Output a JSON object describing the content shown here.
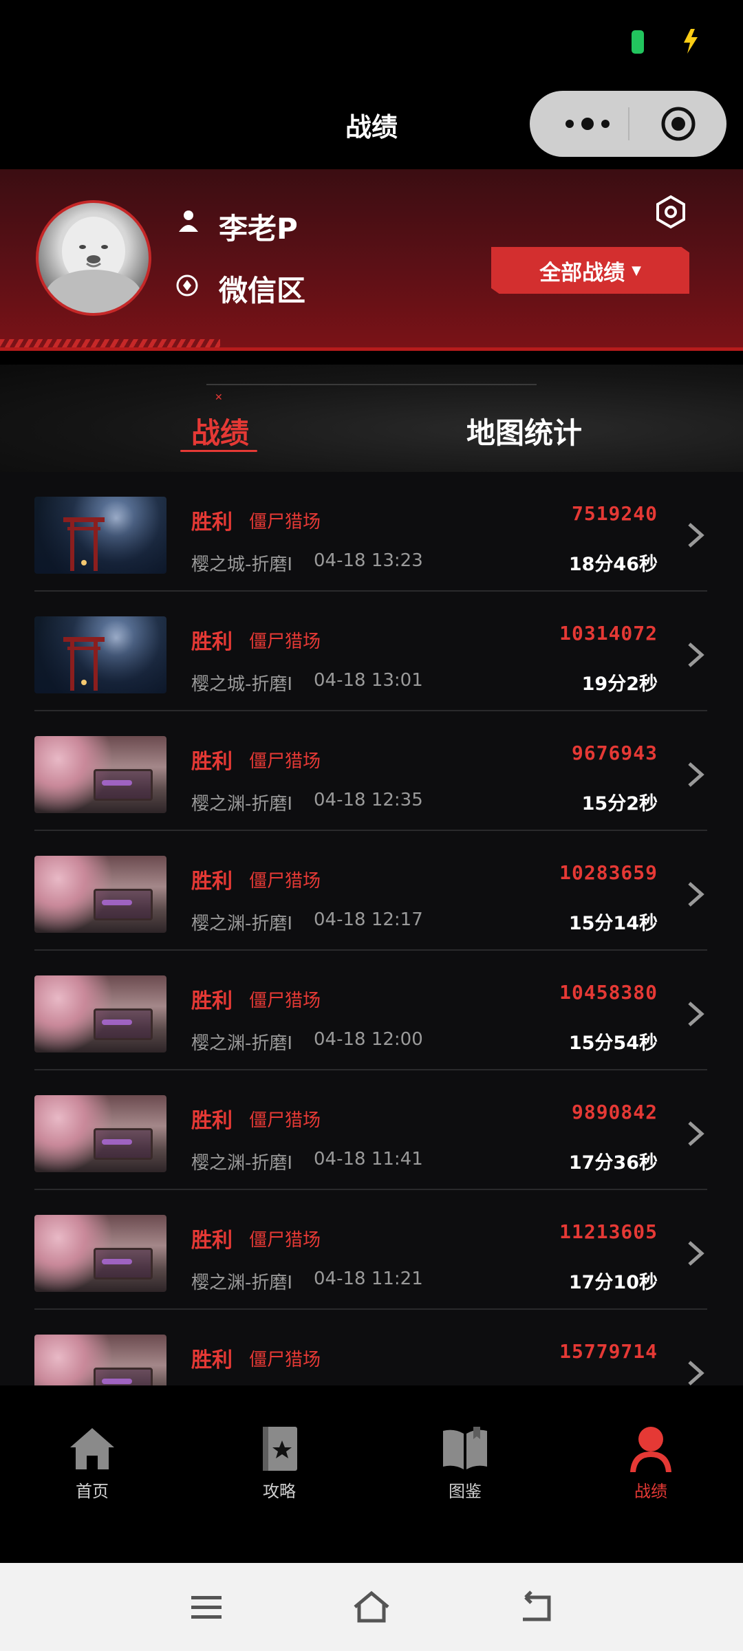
{
  "header": {
    "title": "战绩"
  },
  "profile": {
    "name": "李老P",
    "server": "微信区",
    "all_records_label": "全部战绩"
  },
  "tabs": [
    {
      "label": "战绩",
      "active": true
    },
    {
      "label": "地图统计",
      "active": false
    }
  ],
  "records": [
    {
      "result": "胜利",
      "mode": "僵尸猎场",
      "map": "樱之城-折磨I",
      "time": "04-18 13:23",
      "score": "7519240",
      "duration": "18分46秒",
      "thumb": "castle"
    },
    {
      "result": "胜利",
      "mode": "僵尸猎场",
      "map": "樱之城-折磨I",
      "time": "04-18 13:01",
      "score": "10314072",
      "duration": "19分2秒",
      "thumb": "castle"
    },
    {
      "result": "胜利",
      "mode": "僵尸猎场",
      "map": "樱之渊-折磨I",
      "time": "04-18 12:35",
      "score": "9676943",
      "duration": "15分2秒",
      "thumb": "sakura"
    },
    {
      "result": "胜利",
      "mode": "僵尸猎场",
      "map": "樱之渊-折磨I",
      "time": "04-18 12:17",
      "score": "10283659",
      "duration": "15分14秒",
      "thumb": "sakura"
    },
    {
      "result": "胜利",
      "mode": "僵尸猎场",
      "map": "樱之渊-折磨I",
      "time": "04-18 12:00",
      "score": "10458380",
      "duration": "15分54秒",
      "thumb": "sakura"
    },
    {
      "result": "胜利",
      "mode": "僵尸猎场",
      "map": "樱之渊-折磨I",
      "time": "04-18 11:41",
      "score": "9890842",
      "duration": "17分36秒",
      "thumb": "sakura"
    },
    {
      "result": "胜利",
      "mode": "僵尸猎场",
      "map": "樱之渊-折磨I",
      "time": "04-18 11:21",
      "score": "11213605",
      "duration": "17分10秒",
      "thumb": "sakura"
    },
    {
      "result": "胜利",
      "mode": "僵尸猎场",
      "map": "",
      "time": "",
      "score": "15779714",
      "duration": "",
      "thumb": "sakura"
    }
  ],
  "bottom_nav": [
    {
      "label": "首页",
      "icon": "home-icon",
      "active": false
    },
    {
      "label": "攻略",
      "icon": "guide-book-icon",
      "active": false
    },
    {
      "label": "图鉴",
      "icon": "open-book-icon",
      "active": false
    },
    {
      "label": "战绩",
      "icon": "user-icon",
      "active": true
    }
  ],
  "colors": {
    "accent": "#e53935",
    "panel": "#5c1016",
    "list_bg": "#0d0d0f"
  }
}
